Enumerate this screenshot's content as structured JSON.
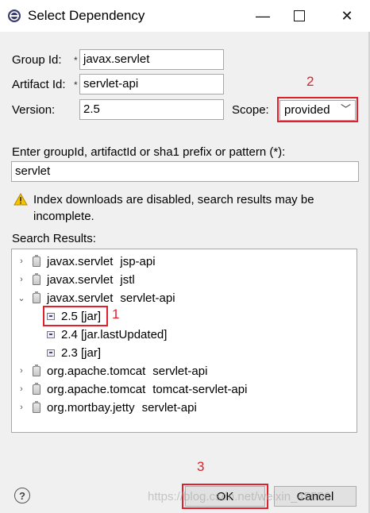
{
  "window": {
    "title": "Select Dependency"
  },
  "form": {
    "group_id_label": "Group Id:",
    "group_id_value": "javax.servlet",
    "artifact_id_label": "Artifact Id:",
    "artifact_id_value": "servlet-api",
    "version_label": "Version:",
    "version_value": "2.5",
    "scope_label": "Scope:",
    "scope_value": "provided",
    "required_marker": "*"
  },
  "search": {
    "label": "Enter groupId, artifactId or sha1 prefix or pattern (*):",
    "value": "servlet"
  },
  "warning": {
    "text": "Index downloads are disabled, search results may be incomplete."
  },
  "results": {
    "label": "Search Results:",
    "rows": [
      {
        "group": "javax.servlet",
        "artifact": "jsp-api",
        "twisty": ">"
      },
      {
        "group": "javax.servlet",
        "artifact": "jstl",
        "twisty": ">"
      },
      {
        "group": "javax.servlet",
        "artifact": "servlet-api",
        "twisty": "v"
      },
      {
        "text": "2.5 [jar]"
      },
      {
        "text": "2.4 [jar.lastUpdated]"
      },
      {
        "text": "2.3 [jar]"
      },
      {
        "group": "org.apache.tomcat",
        "artifact": "servlet-api",
        "twisty": ">"
      },
      {
        "group": "org.apache.tomcat",
        "artifact": "tomcat-servlet-api",
        "twisty": ">"
      },
      {
        "group": "org.mortbay.jetty",
        "artifact": "servlet-api",
        "twisty": ">"
      }
    ]
  },
  "annotations": {
    "one": "1",
    "two": "2",
    "three": "3"
  },
  "buttons": {
    "ok": "OK",
    "cancel": "Cancel",
    "help": "?"
  },
  "watermark": "https://blog.csdn.net/weixin_45556",
  "colors": {
    "annotation_red": "#e0202a",
    "dialog_bg": "#f0f0f0"
  }
}
